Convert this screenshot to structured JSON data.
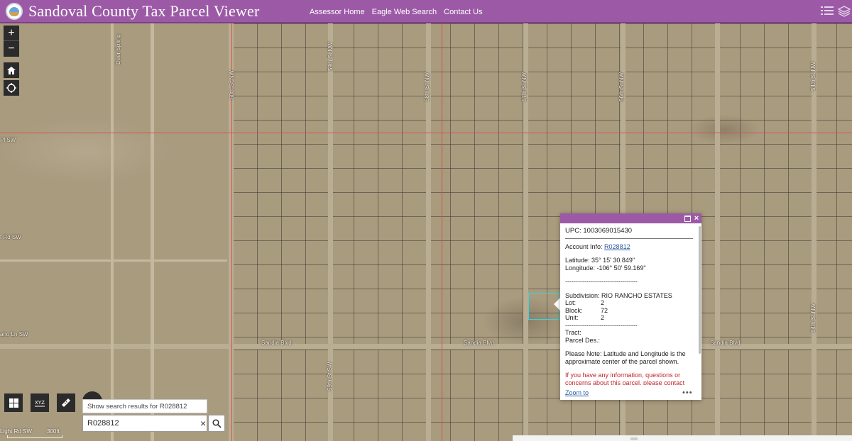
{
  "header": {
    "title": "Sandoval County Tax Parcel Viewer",
    "nav": [
      "Assessor Home",
      "Eagle Web Search",
      "Contact Us"
    ]
  },
  "map": {
    "streets": {
      "deer_spring": "Deer Spring",
      "st60": "60th St NW",
      "st59": "59th St NW",
      "st58": "58th St NW",
      "st57": "57th St NW",
      "st56": "56th St NW",
      "st54_top": "54th St NW",
      "st54_bottom": "54th St NW",
      "st59_sw": "59th St SW",
      "pl_sw": "Pl SW",
      "rd_sw": "t Rd SW",
      "ln_sw": "aho Ln SW",
      "sandia1": "Sandia Blvd",
      "sandia2": "Sandia Blvd",
      "sandia3": "Sandia Blvd",
      "bottom_rd": "Light Rd SW"
    },
    "scale_label": "300ft"
  },
  "search": {
    "suggestion": "Show search results for R028812",
    "value": "R028812",
    "clear_glyph": "×"
  },
  "popup": {
    "close_glyph": "×",
    "upc": "UPC: 1003069015430",
    "account_label": "Account Info: ",
    "account_value": "R028812",
    "latitude": "Latitude: 35° 15' 30.849\"",
    "longitude": "Longitude: -106° 50' 59.169\"",
    "divider1": "----------------------------------",
    "subdivision": "Subdivision: RIO RANCHO ESTATES",
    "lot_label": "Lot:",
    "lot_value": "2",
    "block_label": "Block:",
    "block_value": "72",
    "unit_label": "Unit:",
    "unit_value": "2",
    "divider2": "----------------------------------",
    "tract": "Tract:",
    "parcel_des": "Parcel Des.:",
    "note": "Please Note: Latitude and Longitude is the approximate center of the parcel shown.",
    "red_note": "If you have any information, questions or concerns about this parcel, please contact",
    "zoom_to": "Zoom to",
    "more": "•••"
  },
  "colors": {
    "header_purple": "#9c5aa6",
    "highlight_cyan": "#39d4e0",
    "parcel_line_red": "#d8504a"
  },
  "icons": [
    "county-logo-icon",
    "list-icon",
    "layers-icon",
    "plus-icon",
    "minus-icon",
    "home-icon",
    "locate-icon",
    "basemap-gallery-icon",
    "coordinate-icon",
    "measure-icon",
    "search-icon"
  ]
}
